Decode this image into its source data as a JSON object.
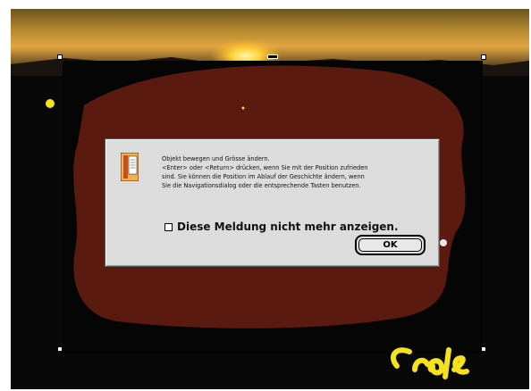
{
  "dialog": {
    "message_lines": [
      "Objekt bewegen und Grösse ändern.",
      "<Enter> oder <Return> drücken, wenn Sie mit der Position zufrieden",
      "sind. Sie können die Position im Ablauf der Geschichte ändern, wenn",
      "Sie die Navigationsdialog oder die entsprechende Tasten benutzen."
    ],
    "checkbox_label": "Diese Meldung nicht mehr anzeigen.",
    "checkbox_checked": false,
    "ok_label": "OK"
  },
  "colors": {
    "brown_scribble": "#5a1a10",
    "yellow_marker": "#f5e21a",
    "blue_marker": "#2a4ad8",
    "dialog_bg": "#dcdcdc"
  },
  "icons": [
    "document-icon"
  ]
}
